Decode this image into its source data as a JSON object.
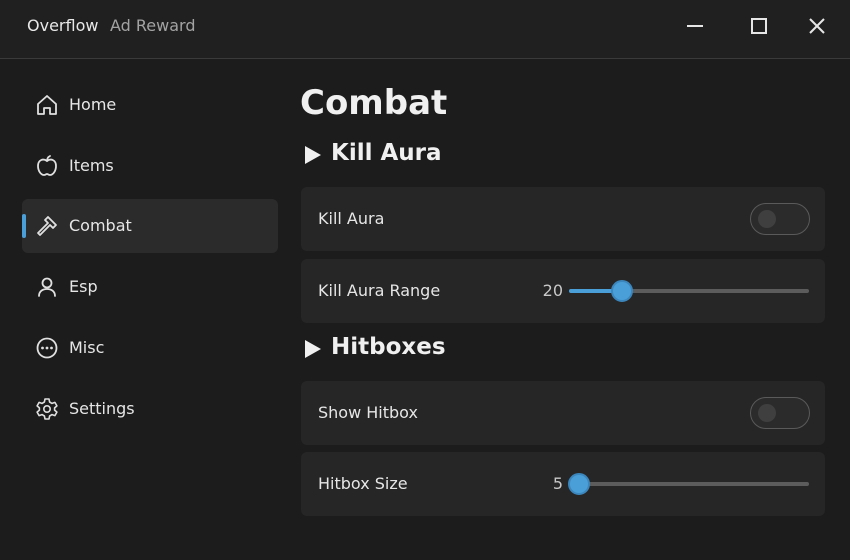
{
  "window": {
    "title": "Overflow",
    "subtitle": "Ad Reward",
    "controls": {
      "minimize": "minimize-icon",
      "maximize": "maximize-icon",
      "close": "close-icon"
    }
  },
  "sidebar": {
    "items": [
      {
        "label": "Home",
        "icon": "home-icon",
        "active": false
      },
      {
        "label": "Items",
        "icon": "apple-icon",
        "active": false
      },
      {
        "label": "Combat",
        "icon": "hammer-icon",
        "active": true
      },
      {
        "label": "Esp",
        "icon": "user-icon",
        "active": false
      },
      {
        "label": "Misc",
        "icon": "more-icon",
        "active": false
      },
      {
        "label": "Settings",
        "icon": "gear-icon",
        "active": false
      }
    ]
  },
  "main": {
    "title": "Combat",
    "sections": [
      {
        "label": "Kill Aura",
        "rows": [
          {
            "type": "toggle",
            "label": "Kill Aura",
            "on": false
          },
          {
            "type": "slider",
            "label": "Kill Aura Range",
            "value": "20",
            "fraction": 0.22
          }
        ]
      },
      {
        "label": "Hitboxes",
        "rows": [
          {
            "type": "toggle",
            "label": "Show Hitbox",
            "on": false
          },
          {
            "type": "slider",
            "label": "Hitbox Size",
            "value": "5",
            "fraction": 0.04
          }
        ]
      }
    ]
  },
  "colors": {
    "accent": "#4a9fd8",
    "background": "#1c1c1c",
    "card": "#262626",
    "active_item": "#2b2b2b"
  }
}
